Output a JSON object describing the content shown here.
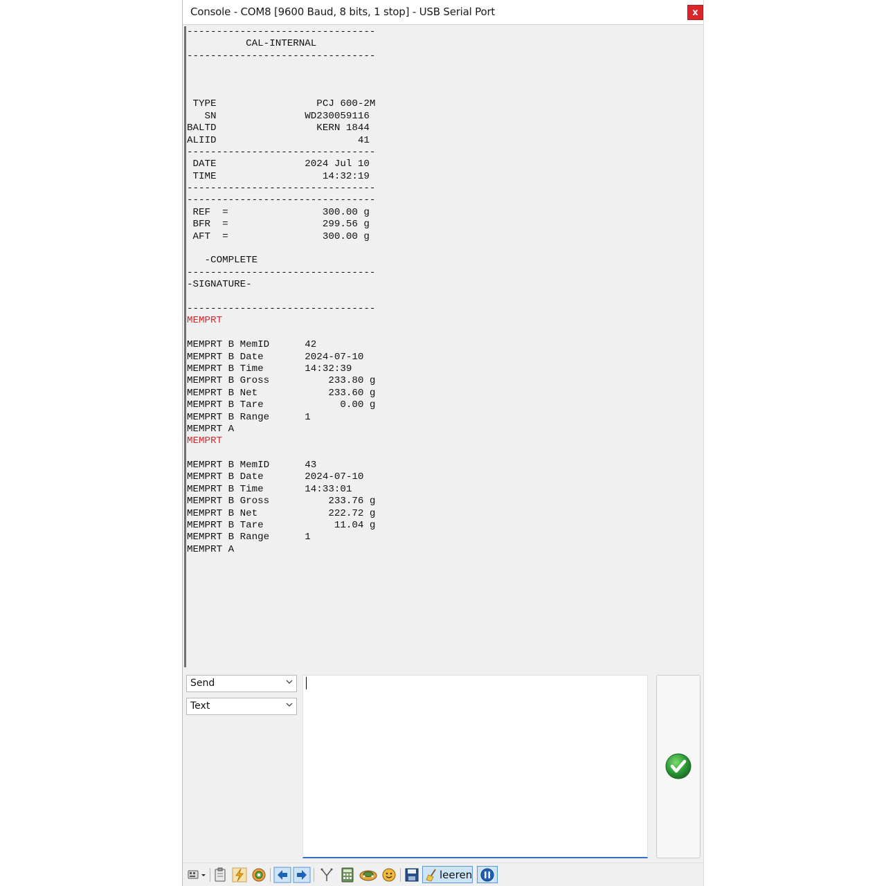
{
  "window": {
    "title": "Console - COM8 [9600 Baud, 8 bits, 1 stop] - USB Serial Port",
    "close_label": "x"
  },
  "console": {
    "lines": [
      {
        "text": "--------------------------------",
        "highlight": false
      },
      {
        "text": "          CAL-INTERNAL",
        "highlight": false
      },
      {
        "text": "--------------------------------",
        "highlight": false
      },
      {
        "text": "",
        "highlight": false
      },
      {
        "text": "",
        "highlight": false
      },
      {
        "text": "",
        "highlight": false
      },
      {
        "text": " TYPE                 PCJ 600-2M",
        "highlight": false
      },
      {
        "text": "   SN               WD230059116",
        "highlight": false
      },
      {
        "text": "BALTD                 KERN 1844",
        "highlight": false
      },
      {
        "text": "ALIID                        41",
        "highlight": false
      },
      {
        "text": "--------------------------------",
        "highlight": false
      },
      {
        "text": " DATE               2024 Jul 10",
        "highlight": false
      },
      {
        "text": " TIME                  14:32:19",
        "highlight": false
      },
      {
        "text": "--------------------------------",
        "highlight": false
      },
      {
        "text": "--------------------------------",
        "highlight": false
      },
      {
        "text": " REF  =                300.00 g",
        "highlight": false
      },
      {
        "text": " BFR  =                299.56 g",
        "highlight": false
      },
      {
        "text": " AFT  =                300.00 g",
        "highlight": false
      },
      {
        "text": "",
        "highlight": false
      },
      {
        "text": "   -COMPLETE",
        "highlight": false
      },
      {
        "text": "--------------------------------",
        "highlight": false
      },
      {
        "text": "-SIGNATURE-",
        "highlight": false
      },
      {
        "text": "",
        "highlight": false
      },
      {
        "text": "--------------------------------",
        "highlight": false
      },
      {
        "text": "MEMPRT",
        "highlight": true
      },
      {
        "text": "",
        "highlight": false
      },
      {
        "text": "MEMPRT B MemID      42",
        "highlight": false
      },
      {
        "text": "MEMPRT B Date       2024-07-10",
        "highlight": false
      },
      {
        "text": "MEMPRT B Time       14:32:39",
        "highlight": false
      },
      {
        "text": "MEMPRT B Gross          233.80 g",
        "highlight": false
      },
      {
        "text": "MEMPRT B Net            233.60 g",
        "highlight": false
      },
      {
        "text": "MEMPRT B Tare             0.00 g",
        "highlight": false
      },
      {
        "text": "MEMPRT B Range      1",
        "highlight": false
      },
      {
        "text": "MEMPRT A",
        "highlight": false
      },
      {
        "text": "MEMPRT",
        "highlight": true
      },
      {
        "text": "",
        "highlight": false
      },
      {
        "text": "MEMPRT B MemID      43",
        "highlight": false
      },
      {
        "text": "MEMPRT B Date       2024-07-10",
        "highlight": false
      },
      {
        "text": "MEMPRT B Time       14:33:01",
        "highlight": false
      },
      {
        "text": "MEMPRT B Gross          233.76 g",
        "highlight": false
      },
      {
        "text": "MEMPRT B Net            222.72 g",
        "highlight": false
      },
      {
        "text": "MEMPRT B Tare            11.04 g",
        "highlight": false
      },
      {
        "text": "MEMPRT B Range      1",
        "highlight": false
      },
      {
        "text": "MEMPRT A",
        "highlight": false
      }
    ],
    "highlight_color": "#d4282a"
  },
  "send": {
    "mode_select": "Send",
    "format_select": "Text",
    "input_value": ""
  },
  "toolbar": {
    "clear_label": "leeren",
    "icons": [
      "keyboard-menu-icon",
      "clipboard-icon",
      "lightning-icon",
      "options-icon",
      "arrow-left-icon",
      "arrow-right-icon",
      "filter-icon",
      "calculator-icon",
      "connect-icon",
      "smiley-icon",
      "save-icon",
      "broom-icon",
      "pause-icon"
    ]
  },
  "colors": {
    "accent": "#2f6cc4",
    "close": "#d8262b",
    "ok_green": "#2e9e3a"
  }
}
